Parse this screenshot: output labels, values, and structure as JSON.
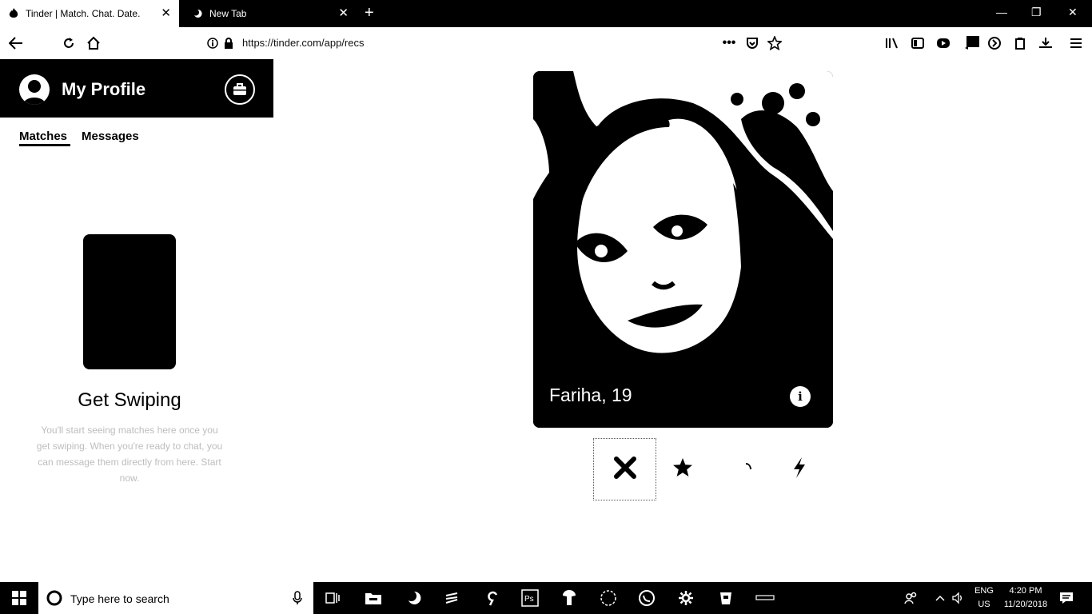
{
  "browser": {
    "tabs": [
      {
        "title": "Tinder | Match. Chat. Date.",
        "active": true
      },
      {
        "title": "New Tab",
        "active": false
      }
    ],
    "url": "https://tinder.com/app/recs"
  },
  "sidebar": {
    "title": "My Profile",
    "tabs": [
      "Matches",
      "Messages"
    ],
    "empty_title": "Get Swiping",
    "empty_description": "You'll start seeing matches here once you get swiping. When you're ready to chat, you can message them directly from here. Start now."
  },
  "card": {
    "name_age": "Fariha, 19"
  },
  "taskbar": {
    "search_placeholder": "Type here to search",
    "language_line1": "ENG",
    "language_line2": "US",
    "time": "4:20 PM",
    "date": "11/20/2018"
  },
  "icons": {
    "back": "back-arrow-icon",
    "reload": "reload-icon",
    "home": "home-icon",
    "nope": "close-x-icon",
    "superlike": "star-icon",
    "like": "heart-icon",
    "boost": "lightning-icon"
  },
  "colors": {
    "header_bg": "#000000",
    "page_bg": "#ffffff"
  }
}
